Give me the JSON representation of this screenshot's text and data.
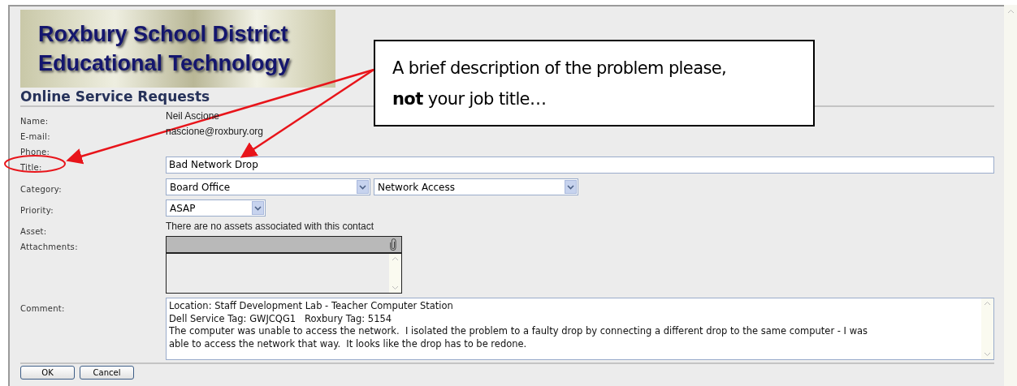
{
  "logo": {
    "lines": [
      "Roxbury School District",
      "Educational Technology"
    ]
  },
  "form": {
    "heading": "Online Service Requests",
    "fields": [
      {
        "kind": "text",
        "label": "Name:",
        "value": "Neil Ascione"
      },
      {
        "kind": "text",
        "label": "E-mail:",
        "value": "nascione@roxbury.org"
      },
      {
        "kind": "text",
        "label": "Phone:"
      },
      {
        "kind": "input",
        "label": "Title:",
        "value": "Bad Network Drop"
      },
      {
        "kind": "selects",
        "label": "Category:",
        "selects": [
          "Board Office",
          "Network Access"
        ]
      },
      {
        "kind": "selects",
        "label": "Priority:",
        "selects": [
          "ASAP"
        ]
      },
      {
        "kind": "text",
        "label": "Asset:",
        "value": "There are no assets associated with this contact"
      },
      {
        "kind": "attachments",
        "label": "Attachments:"
      },
      {
        "kind": "comment",
        "label": "Comment:",
        "lines": [
          "Location: Staff Development Lab - Teacher Computer Station",
          "Dell Service Tag: GWJCQG1   Roxbury Tag: 5154",
          "The computer was unable to access the network.  I isolated the problem to a faulty drop by connecting a different drop to the same computer - I was",
          "able to access the network that way.  It looks like the drop has to be redone."
        ]
      }
    ],
    "buttons": [
      "OK",
      "Cancel"
    ]
  },
  "callout": {
    "lines": [
      "A brief description of the problem please,",
      "**not** your job title…"
    ]
  }
}
